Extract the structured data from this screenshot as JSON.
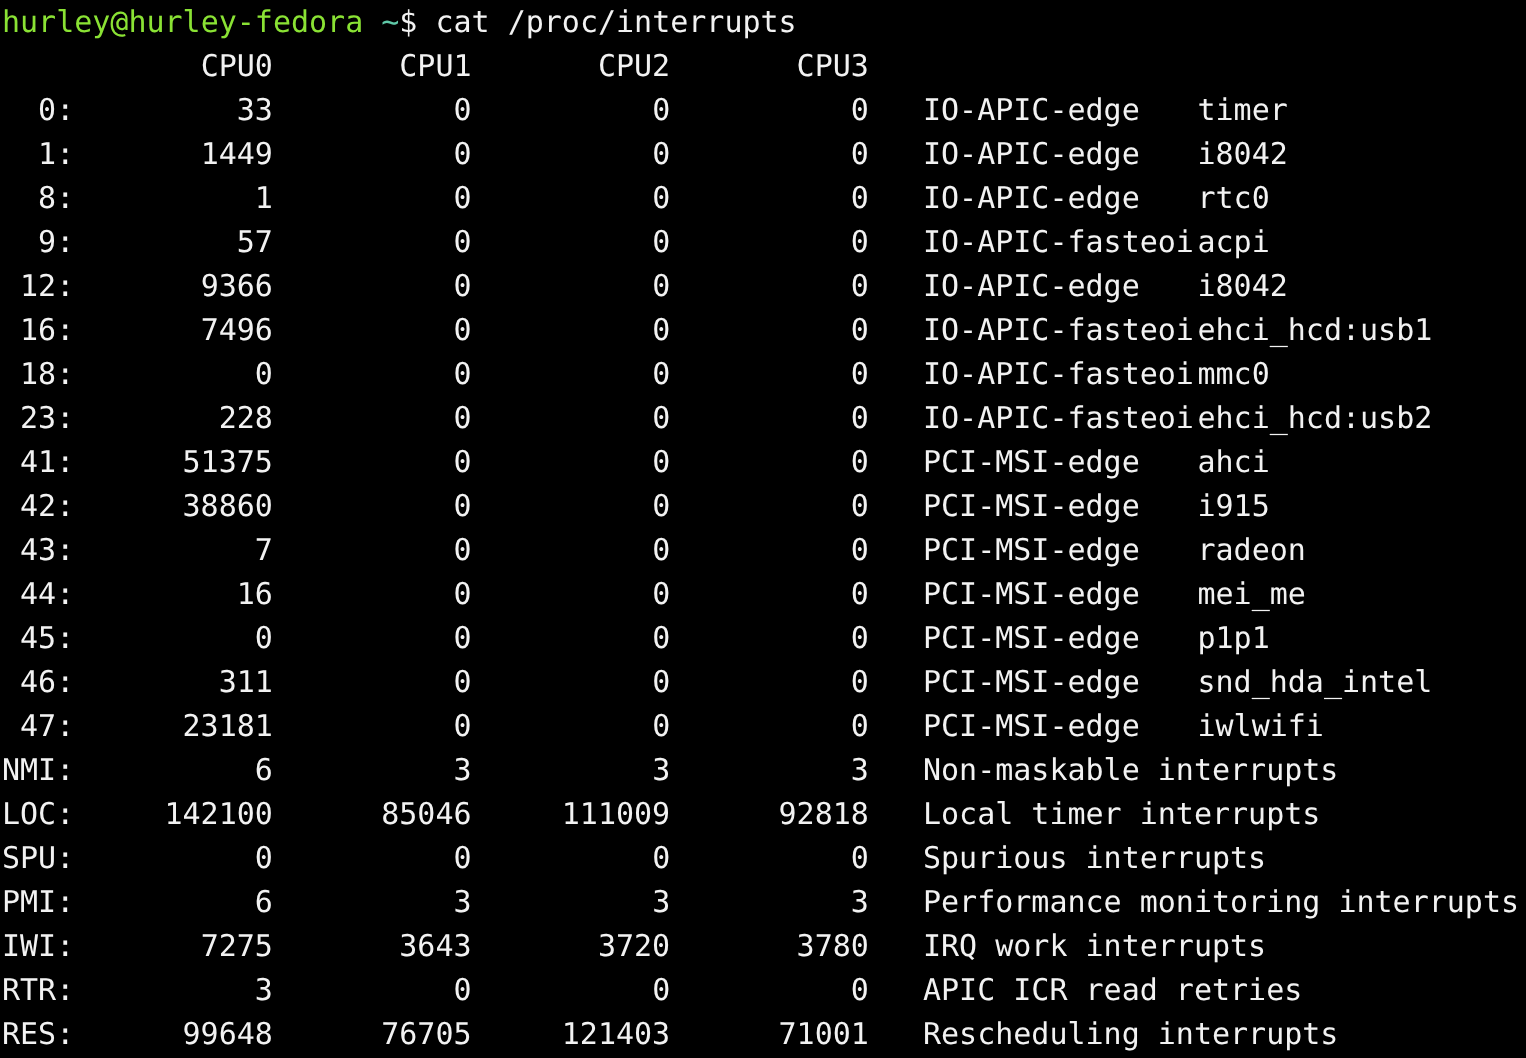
{
  "prompt": {
    "user_host": "hurley@hurley-fedora",
    "cwd": "~",
    "symbol": "$",
    "command": "cat /proc/interrupts"
  },
  "header": [
    "CPU0",
    "CPU1",
    "CPU2",
    "CPU3"
  ],
  "rows": [
    {
      "kind": "device",
      "irq": "0:",
      "counts": [
        "33",
        "0",
        "0",
        "0"
      ],
      "type": "IO-APIC-edge",
      "name": "timer"
    },
    {
      "kind": "device",
      "irq": "1:",
      "counts": [
        "1449",
        "0",
        "0",
        "0"
      ],
      "type": "IO-APIC-edge",
      "name": "i8042"
    },
    {
      "kind": "device",
      "irq": "8:",
      "counts": [
        "1",
        "0",
        "0",
        "0"
      ],
      "type": "IO-APIC-edge",
      "name": "rtc0"
    },
    {
      "kind": "device",
      "irq": "9:",
      "counts": [
        "57",
        "0",
        "0",
        "0"
      ],
      "type": "IO-APIC-fasteoi",
      "name": "acpi"
    },
    {
      "kind": "device",
      "irq": "12:",
      "counts": [
        "9366",
        "0",
        "0",
        "0"
      ],
      "type": "IO-APIC-edge",
      "name": "i8042"
    },
    {
      "kind": "device",
      "irq": "16:",
      "counts": [
        "7496",
        "0",
        "0",
        "0"
      ],
      "type": "IO-APIC-fasteoi",
      "name": "ehci_hcd:usb1"
    },
    {
      "kind": "device",
      "irq": "18:",
      "counts": [
        "0",
        "0",
        "0",
        "0"
      ],
      "type": "IO-APIC-fasteoi",
      "name": "mmc0"
    },
    {
      "kind": "device",
      "irq": "23:",
      "counts": [
        "228",
        "0",
        "0",
        "0"
      ],
      "type": "IO-APIC-fasteoi",
      "name": "ehci_hcd:usb2"
    },
    {
      "kind": "device",
      "irq": "41:",
      "counts": [
        "51375",
        "0",
        "0",
        "0"
      ],
      "type": "PCI-MSI-edge",
      "name": "ahci"
    },
    {
      "kind": "device",
      "irq": "42:",
      "counts": [
        "38860",
        "0",
        "0",
        "0"
      ],
      "type": "PCI-MSI-edge",
      "name": "i915"
    },
    {
      "kind": "device",
      "irq": "43:",
      "counts": [
        "7",
        "0",
        "0",
        "0"
      ],
      "type": "PCI-MSI-edge",
      "name": "radeon"
    },
    {
      "kind": "device",
      "irq": "44:",
      "counts": [
        "16",
        "0",
        "0",
        "0"
      ],
      "type": "PCI-MSI-edge",
      "name": "mei_me"
    },
    {
      "kind": "device",
      "irq": "45:",
      "counts": [
        "0",
        "0",
        "0",
        "0"
      ],
      "type": "PCI-MSI-edge",
      "name": "p1p1"
    },
    {
      "kind": "device",
      "irq": "46:",
      "counts": [
        "311",
        "0",
        "0",
        "0"
      ],
      "type": "PCI-MSI-edge",
      "name": "snd_hda_intel"
    },
    {
      "kind": "device",
      "irq": "47:",
      "counts": [
        "23181",
        "0",
        "0",
        "0"
      ],
      "type": "PCI-MSI-edge",
      "name": "iwlwifi"
    },
    {
      "kind": "summary",
      "irq": "NMI:",
      "counts": [
        "6",
        "3",
        "3",
        "3"
      ],
      "description": "Non-maskable interrupts"
    },
    {
      "kind": "summary",
      "irq": "LOC:",
      "counts": [
        "142100",
        "85046",
        "111009",
        "92818"
      ],
      "description": "Local timer interrupts"
    },
    {
      "kind": "summary",
      "irq": "SPU:",
      "counts": [
        "0",
        "0",
        "0",
        "0"
      ],
      "description": "Spurious interrupts"
    },
    {
      "kind": "summary",
      "irq": "PMI:",
      "counts": [
        "6",
        "3",
        "3",
        "3"
      ],
      "description": "Performance monitoring interrupts"
    },
    {
      "kind": "summary",
      "irq": "IWI:",
      "counts": [
        "7275",
        "3643",
        "3720",
        "3780"
      ],
      "description": "IRQ work interrupts"
    },
    {
      "kind": "summary",
      "irq": "RTR:",
      "counts": [
        "3",
        "0",
        "0",
        "0"
      ],
      "description": "APIC ICR read retries"
    },
    {
      "kind": "summary",
      "irq": "RES:",
      "counts": [
        "99648",
        "76705",
        "121403",
        "71001"
      ],
      "description": "Rescheduling interrupts"
    }
  ]
}
